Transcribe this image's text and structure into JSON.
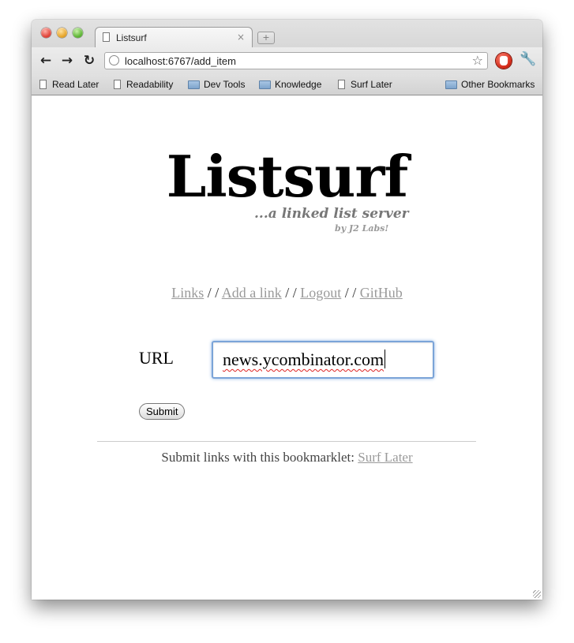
{
  "browser": {
    "tab_title": "Listsurf",
    "tab_close": "×",
    "new_tab": "+",
    "url": "localhost:6767/add_item",
    "icons": {
      "back": "back-arrow-icon",
      "forward": "forward-arrow-icon",
      "reload": "reload-icon",
      "bookmark_star": "star-icon",
      "extension": "stop-hand-icon",
      "menu": "wrench-icon"
    },
    "bookmarks": [
      {
        "label": "Read Later",
        "type": "page"
      },
      {
        "label": "Readability",
        "type": "page"
      },
      {
        "label": "Dev Tools",
        "type": "folder"
      },
      {
        "label": "Knowledge",
        "type": "folder"
      },
      {
        "label": "Surf Later",
        "type": "page"
      }
    ],
    "other_bookmarks": "Other Bookmarks"
  },
  "page": {
    "logo": "Listsurf",
    "tagline": "...a linked list server",
    "byline": "by J2 Labs!",
    "nav": {
      "links": "Links",
      "add_link": "Add a link",
      "logout": "Logout",
      "github": "GitHub",
      "separator": "/ /"
    },
    "form": {
      "url_label": "URL",
      "url_value": "news.ycombinator.com",
      "submit_label": "Submit"
    },
    "footer": {
      "text": "Submit links with this bookmarklet:",
      "bookmarklet_link": "Surf Later"
    }
  }
}
